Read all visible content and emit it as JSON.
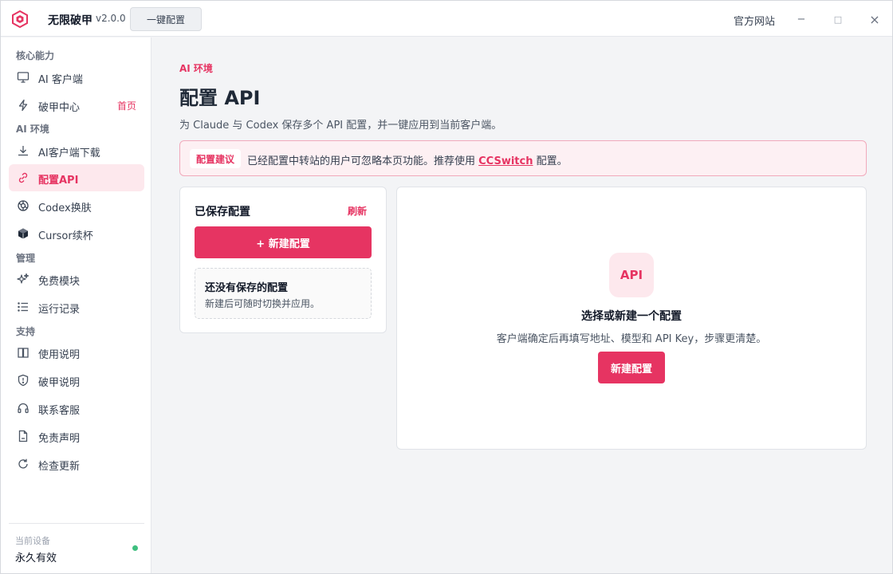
{
  "titlebar": {
    "app_name": "无限破甲",
    "version": "v2.0.0",
    "oneclick_label": "一键配置",
    "official_site": "官方网站",
    "minimize": "−",
    "maximize": "□",
    "close": "×"
  },
  "sidebar": {
    "sections": [
      {
        "label": "核心能力"
      },
      {
        "label": "AI 环境"
      },
      {
        "label": "管理"
      },
      {
        "label": "支持"
      }
    ],
    "items": [
      {
        "label": "AI 客户端",
        "icon": "monitor-icon"
      },
      {
        "label": "破甲中心",
        "icon": "bolt-icon",
        "badge": "首页"
      },
      {
        "label": "AI客户端下载",
        "icon": "download-icon"
      },
      {
        "label": "配置API",
        "icon": "link-icon"
      },
      {
        "label": "Codex换肤",
        "icon": "openai-icon"
      },
      {
        "label": "Cursor续杯",
        "icon": "cube-icon"
      },
      {
        "label": "免费模块",
        "icon": "sparkle-icon"
      },
      {
        "label": "运行记录",
        "icon": "list-icon"
      },
      {
        "label": "使用说明",
        "icon": "book-icon"
      },
      {
        "label": "破甲说明",
        "icon": "shield-icon"
      },
      {
        "label": "联系客服",
        "icon": "headset-icon"
      },
      {
        "label": "免责声明",
        "icon": "document-icon"
      },
      {
        "label": "检查更新",
        "icon": "refresh-icon"
      }
    ],
    "active_index": 3,
    "device_label": "当前设备",
    "device_status": "永久有效",
    "status_color": "#3fbf7f"
  },
  "main": {
    "eyebrow": "AI 环境",
    "title": "配置 API",
    "description": "为 Claude 与 Codex 保存多个 API 配置，并一键应用到当前客户端。",
    "notice": {
      "tag": "配置建议",
      "text_before": "已经配置中转站的用户可忽略本页功能。推荐使用 ",
      "link": "CCSwitch",
      "text_after": " 配置。"
    },
    "saved": {
      "title": "已保存配置",
      "refresh": "刷新",
      "new_button": "+  新建配置",
      "empty_title": "还没有保存的配置",
      "empty_desc": "新建后可随时切换并应用。"
    },
    "detail": {
      "badge": "API",
      "title": "选择或新建一个配置",
      "description": "客户端确定后再填写地址、模型和 API Key，步骤更清楚。",
      "new_button": "新建配置"
    }
  },
  "colors": {
    "accent": "#e63462",
    "accent_light": "#fde8ed"
  }
}
